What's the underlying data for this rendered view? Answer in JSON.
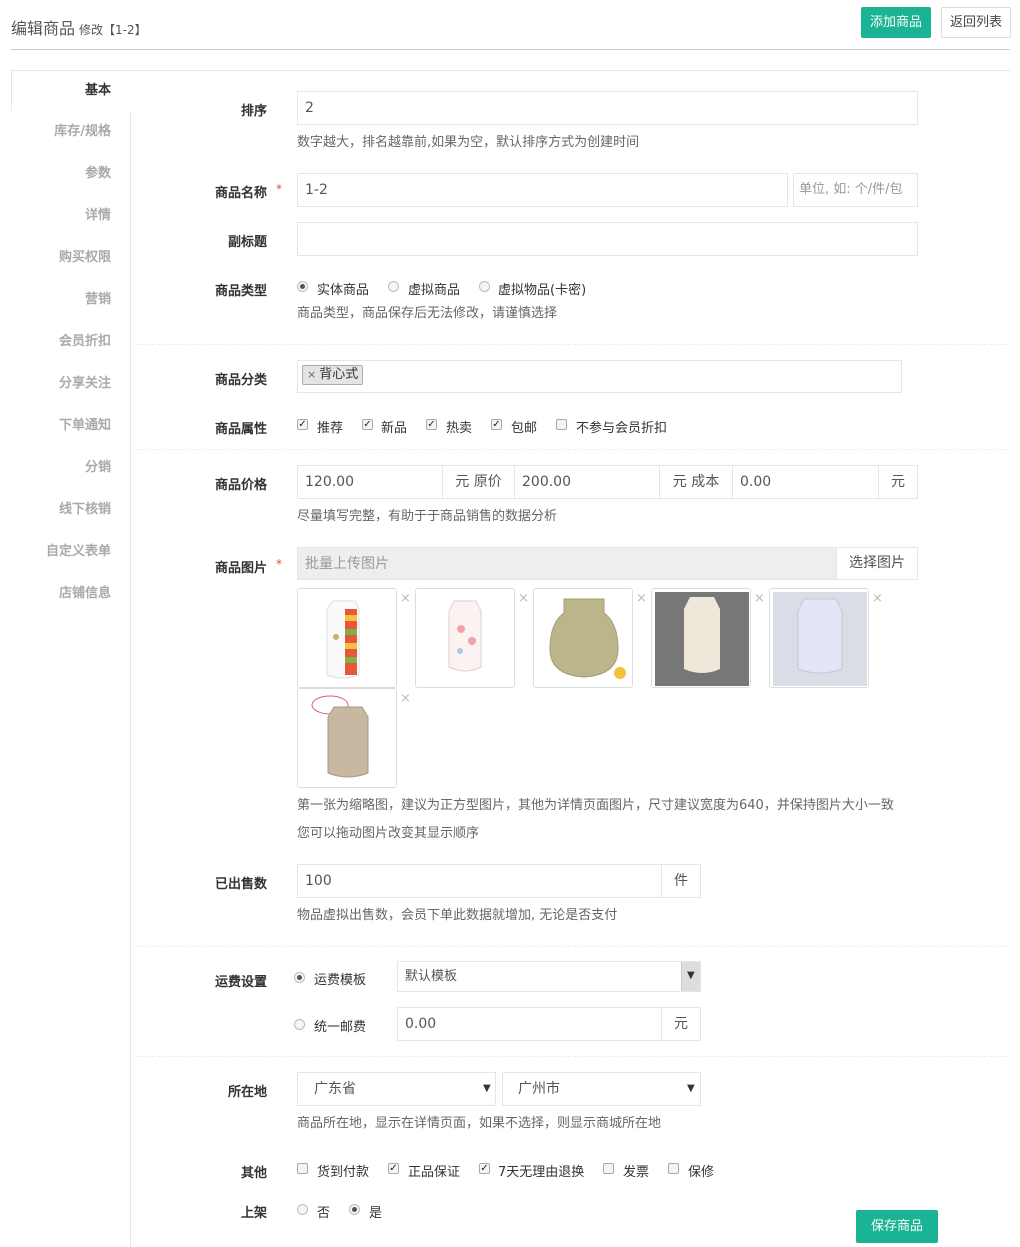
{
  "header": {
    "title": "编辑商品",
    "subtitle": "修改【1-2】",
    "add_btn": "添加商品",
    "back_btn": "返回列表"
  },
  "tabs": [
    "基本",
    "库存/规格",
    "参数",
    "详情",
    "购买权限",
    "营销",
    "会员折扣",
    "分享关注",
    "下单通知",
    "分销",
    "线下核销",
    "自定义表单",
    "店铺信息"
  ],
  "sort": {
    "label": "排序",
    "value": "2",
    "help": "数字越大，排名越靠前,如果为空，默认排序方式为创建时间"
  },
  "name": {
    "label": "商品名称",
    "required": "*",
    "value": "1-2",
    "unit_placeholder": "单位, 如: 个/件/包"
  },
  "subtitle_field": {
    "label": "副标题",
    "value": ""
  },
  "type": {
    "label": "商品类型",
    "options": [
      "实体商品",
      "虚拟商品",
      "虚拟物品(卡密)"
    ],
    "selected": 0,
    "help": "商品类型，商品保存后无法修改，请谨慎选择"
  },
  "category": {
    "label": "商品分类",
    "remove": "×",
    "tag": "背心式"
  },
  "attributes": {
    "label": "商品属性",
    "options": [
      {
        "text": "推荐",
        "checked": true
      },
      {
        "text": "新品",
        "checked": true
      },
      {
        "text": "热卖",
        "checked": true
      },
      {
        "text": "包邮",
        "checked": true
      },
      {
        "text": "不参与会员折扣",
        "checked": false
      }
    ]
  },
  "price": {
    "label": "商品价格",
    "price": "120.00",
    "addon1": "元 原价",
    "original": "200.00",
    "addon2": "元 成本",
    "cost": "0.00",
    "addon3": "元",
    "help": "尽量填写完整，有助于于商品销售的数据分析"
  },
  "images": {
    "label": "商品图片",
    "required": "*",
    "placeholder": "批量上传图片",
    "select_btn": "选择图片",
    "delete": "×",
    "count": 6,
    "help1": "第一张为缩略图，建议为正方型图片，其他为详情页面图片，尺寸建议宽度为640，并保持图片大小一致",
    "help2": "您可以拖动图片改变其显示顺序"
  },
  "sold": {
    "label": "已出售数",
    "value": "100",
    "unit": "件",
    "help": "物品虚拟出售数，会员下单此数据就增加, 无论是否支付"
  },
  "shipping": {
    "label": "运费设置",
    "opt_template": "运费模板",
    "template_value": "默认模板",
    "opt_flat": "统一邮费",
    "flat_value": "0.00",
    "flat_unit": "元",
    "selected": 0
  },
  "location": {
    "label": "所在地",
    "province": "广东省",
    "city": "广州市",
    "help": "商品所在地，显示在详情页面，如果不选择，则显示商城所在地"
  },
  "other": {
    "label": "其他",
    "options": [
      {
        "text": "货到付款",
        "checked": false
      },
      {
        "text": "正品保证",
        "checked": true
      },
      {
        "text": "7天无理由退换",
        "checked": true
      },
      {
        "text": "发票",
        "checked": false
      },
      {
        "text": "保修",
        "checked": false
      }
    ]
  },
  "listing": {
    "label": "上架",
    "options": [
      "否",
      "是"
    ],
    "selected": 1
  },
  "save_btn": "保存商品"
}
